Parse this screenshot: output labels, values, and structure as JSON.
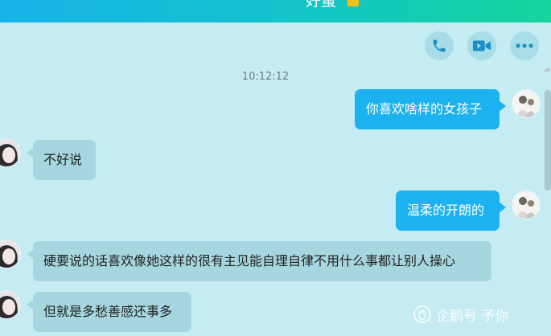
{
  "header": {
    "title": "好蛋"
  },
  "toolbar": {
    "call_icon": "phone-icon",
    "video_icon": "video-camera-icon",
    "more_icon": "more-dots-icon"
  },
  "chat": {
    "timestamp": "10:12:12",
    "messages": [
      {
        "side": "right",
        "text": "你喜欢啥样的女孩子"
      },
      {
        "side": "left",
        "text": "不好说"
      },
      {
        "side": "right",
        "text": "温柔的开朗的"
      },
      {
        "side": "left",
        "text": "硬要说的话喜欢像她这样的很有主见能自理自律不用什么事都让别人操心"
      },
      {
        "side": "left",
        "text": "但就是多愁善感还事多"
      }
    ]
  },
  "watermark": {
    "text": "企鹅号 予你"
  },
  "colors": {
    "background": "#c4ecf2",
    "header_gradient_start": "#17b3e8",
    "header_gradient_end": "#16d49c",
    "outgoing_bubble": "#1cb2ef",
    "incoming_bubble": "#a6d7e0",
    "icon_color": "#1b8fc6"
  }
}
